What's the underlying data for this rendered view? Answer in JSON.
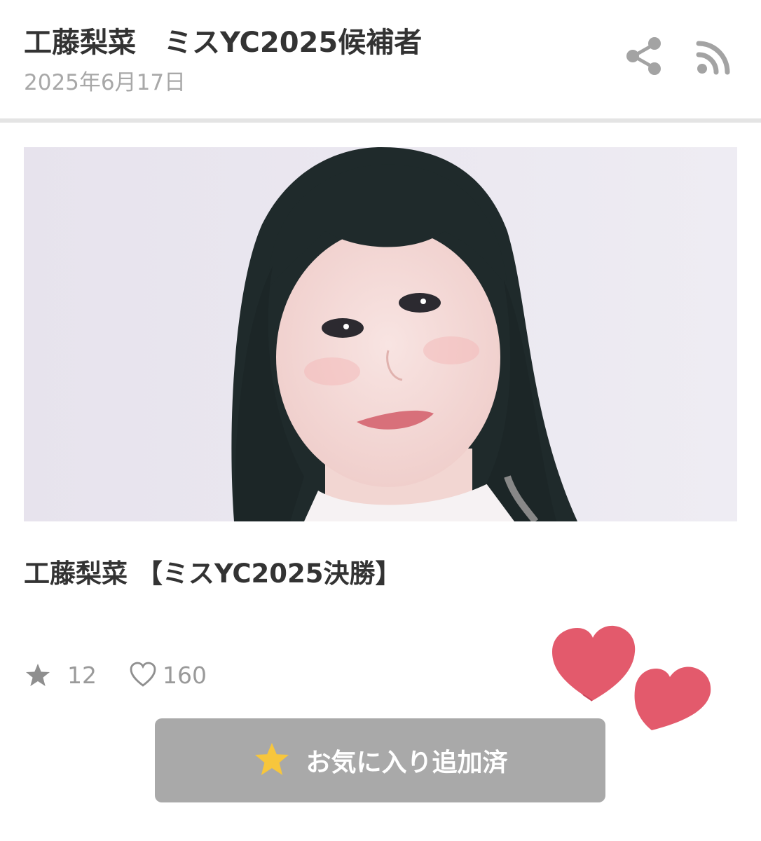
{
  "header": {
    "title": "工藤梨菜　ミスYC2025候補者",
    "date": "2025年6月17日",
    "share_icon": "share-icon",
    "rss_icon": "rss-icon"
  },
  "article": {
    "photo_icon": "portrait-photo",
    "caption": "工藤梨菜 【ミスYC2025決勝】"
  },
  "stats": {
    "star_icon": "star-icon",
    "star_count": "12",
    "heart_icon": "heart-outline-icon",
    "heart_count": "160"
  },
  "decoration": {
    "icon": "hearts-sticker",
    "color": "#e35a6c"
  },
  "favorite_button": {
    "label": "お気に入り追加済",
    "icon": "star-icon",
    "background": "#a9a9a9",
    "star_color": "#f7c63c"
  }
}
